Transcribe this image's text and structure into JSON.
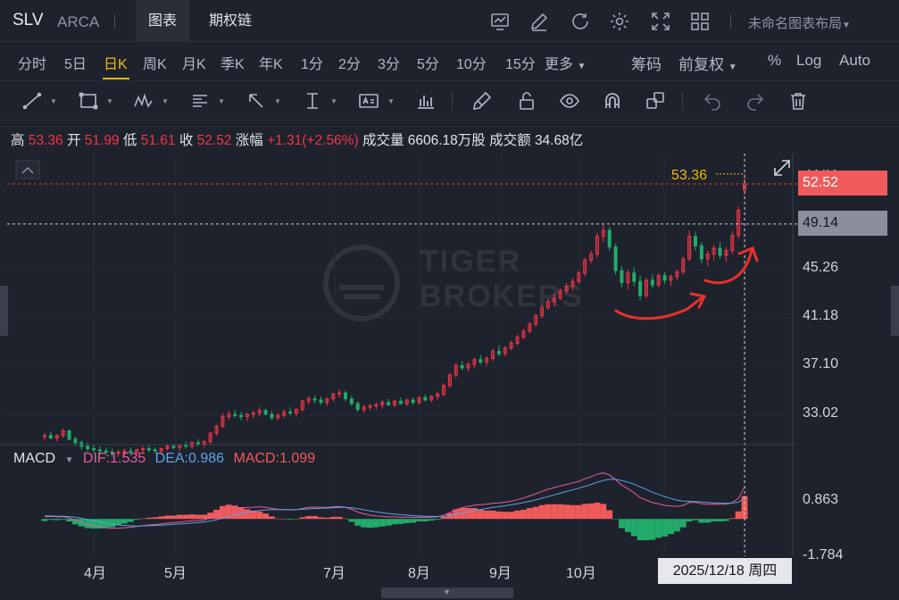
{
  "header": {
    "symbol": "SLV",
    "exchange": "ARCA",
    "tabs": [
      "图表",
      "期权链"
    ],
    "active_tab": 0,
    "layout_name": "未命名图表布局",
    "icons": [
      "chart-indicator-icon",
      "draw-pen-icon",
      "refresh-icon",
      "settings-gear-icon",
      "fullscreen-icon",
      "grid-layout-icon"
    ]
  },
  "periods": {
    "items": [
      "分时",
      "5日",
      "日K",
      "周K",
      "月K",
      "季K",
      "年K",
      "1分",
      "2分",
      "3分",
      "5分",
      "10分",
      "15分",
      "更多"
    ],
    "active": "日K",
    "right_options": [
      "筹码",
      "前复权",
      "%",
      "Log",
      "Auto"
    ]
  },
  "drawing_tools": [
    "trend-line-icon",
    "rectangle-icon",
    "pattern-icon",
    "text-list-icon",
    "arrow-icon",
    "measure-icon",
    "text-annotation-icon",
    "bar-pattern-icon",
    "brush-icon",
    "lock-icon",
    "eye-icon",
    "magnet-icon",
    "layers-icon",
    "undo-icon",
    "redo-icon",
    "trash-icon"
  ],
  "quote": {
    "high_label": "高",
    "high": "53.36",
    "open_label": "开",
    "open": "51.99",
    "low_label": "低",
    "low": "51.61",
    "close_label": "收",
    "close": "52.52",
    "change_label": "涨幅",
    "change": "+1.31(+2.56%)",
    "volume_label": "成交量",
    "volume": "6606.18万股",
    "turnover_label": "成交额",
    "turnover": "34.68亿"
  },
  "price_axis": {
    "top_partial": "53.42",
    "labels": [
      "45.26",
      "41.18",
      "37.10",
      "33.02"
    ],
    "current_price": "52.52",
    "crosshair_price": "49.14",
    "high_marker": "53.36"
  },
  "macd": {
    "title": "MACD",
    "dif_label": "DIF:",
    "dif": "1.535",
    "dea_label": "DEA:",
    "dea": "0.986",
    "macd_label": "MACD:",
    "macd": "1.099",
    "axis_labels": [
      "0.863",
      "-1.784"
    ]
  },
  "time_axis": {
    "months": [
      "4月",
      "5月",
      "7月",
      "8月",
      "9月",
      "10月"
    ],
    "crosshair_date": "2025/12/18 周四"
  },
  "watermark": "TIGER BROKERS",
  "colors": {
    "up": "#f23645",
    "down": "#22ab6a",
    "dif": "#e55d9b",
    "dea": "#5ba3e6",
    "accent": "#f0b90b",
    "annotation": "#e8312a"
  },
  "chart_data": {
    "type": "candlestick",
    "ylim": [
      30.0,
      54.0
    ],
    "macd_ylim": [
      -1.9,
      2.3
    ],
    "candles": [
      [
        31.2,
        31.5,
        30.9,
        31.3
      ],
      [
        31.3,
        31.6,
        31.0,
        31.1
      ],
      [
        31.1,
        31.4,
        30.8,
        31.3
      ],
      [
        31.3,
        31.9,
        31.1,
        31.7
      ],
      [
        31.7,
        31.8,
        30.9,
        31.0
      ],
      [
        31.0,
        31.2,
        30.4,
        30.7
      ],
      [
        30.7,
        30.9,
        30.1,
        30.4
      ],
      [
        30.4,
        30.7,
        29.9,
        30.2
      ],
      [
        30.2,
        30.5,
        29.8,
        30.1
      ],
      [
        30.1,
        30.4,
        29.7,
        30.0
      ],
      [
        30.0,
        30.3,
        29.6,
        29.9
      ],
      [
        29.9,
        30.2,
        29.5,
        29.8
      ],
      [
        29.8,
        30.1,
        29.5,
        29.9
      ],
      [
        29.9,
        30.2,
        29.6,
        30.0
      ],
      [
        30.0,
        30.3,
        29.7,
        29.9
      ],
      [
        29.9,
        30.2,
        29.6,
        30.1
      ],
      [
        30.1,
        30.4,
        29.8,
        30.2
      ],
      [
        30.2,
        30.5,
        29.9,
        30.1
      ],
      [
        30.1,
        30.3,
        29.8,
        30.0
      ],
      [
        30.0,
        30.3,
        29.7,
        30.2
      ],
      [
        30.2,
        30.6,
        30.0,
        30.4
      ],
      [
        30.4,
        30.6,
        30.1,
        30.3
      ],
      [
        30.3,
        30.6,
        30.0,
        30.5
      ],
      [
        30.5,
        30.8,
        30.2,
        30.4
      ],
      [
        30.4,
        30.8,
        30.2,
        30.7
      ],
      [
        30.7,
        31.0,
        30.4,
        30.6
      ],
      [
        30.6,
        30.9,
        30.3,
        30.8
      ],
      [
        30.8,
        31.6,
        30.6,
        31.5
      ],
      [
        31.5,
        32.2,
        31.3,
        32.1
      ],
      [
        32.1,
        33.2,
        31.9,
        32.9
      ],
      [
        32.9,
        33.4,
        32.6,
        33.1
      ],
      [
        33.1,
        33.5,
        32.8,
        33.0
      ],
      [
        33.0,
        33.3,
        32.6,
        32.9
      ],
      [
        32.9,
        33.2,
        32.5,
        33.1
      ],
      [
        33.1,
        33.4,
        32.8,
        33.2
      ],
      [
        33.2,
        33.7,
        32.9,
        33.4
      ],
      [
        33.4,
        33.6,
        33.0,
        33.1
      ],
      [
        33.1,
        33.4,
        32.6,
        32.8
      ],
      [
        32.8,
        33.2,
        32.6,
        33.0
      ],
      [
        33.0,
        33.5,
        32.8,
        33.3
      ],
      [
        33.3,
        33.7,
        33.0,
        33.2
      ],
      [
        33.2,
        33.6,
        32.9,
        33.5
      ],
      [
        33.5,
        34.3,
        33.3,
        34.2
      ],
      [
        34.2,
        34.6,
        33.9,
        34.4
      ],
      [
        34.4,
        34.7,
        34.0,
        34.3
      ],
      [
        34.3,
        34.6,
        33.9,
        34.1
      ],
      [
        34.1,
        34.5,
        33.8,
        34.4
      ],
      [
        34.4,
        34.9,
        34.2,
        34.8
      ],
      [
        34.8,
        35.2,
        34.5,
        34.9
      ],
      [
        34.9,
        35.1,
        34.2,
        34.4
      ],
      [
        34.4,
        34.7,
        33.8,
        34.0
      ],
      [
        34.0,
        34.2,
        33.3,
        33.5
      ],
      [
        33.5,
        33.9,
        33.2,
        33.7
      ],
      [
        33.7,
        34.0,
        33.4,
        33.8
      ],
      [
        33.8,
        34.1,
        33.5,
        33.9
      ],
      [
        33.9,
        34.3,
        33.6,
        34.1
      ],
      [
        34.1,
        34.4,
        33.8,
        33.9
      ],
      [
        33.9,
        34.3,
        33.7,
        34.2
      ],
      [
        34.2,
        34.5,
        33.9,
        34.0
      ],
      [
        34.0,
        34.4,
        33.8,
        34.3
      ],
      [
        34.3,
        34.5,
        33.9,
        34.1
      ],
      [
        34.1,
        34.6,
        33.9,
        34.5
      ],
      [
        34.5,
        34.8,
        34.2,
        34.3
      ],
      [
        34.3,
        34.7,
        34.1,
        34.6
      ],
      [
        34.6,
        35.0,
        34.3,
        34.8
      ],
      [
        34.8,
        35.7,
        34.6,
        35.5
      ],
      [
        35.5,
        36.6,
        35.3,
        36.4
      ],
      [
        36.4,
        37.4,
        36.2,
        37.2
      ],
      [
        37.2,
        37.6,
        36.8,
        37.0
      ],
      [
        37.0,
        37.5,
        36.7,
        37.3
      ],
      [
        37.3,
        37.9,
        37.0,
        37.7
      ],
      [
        37.7,
        38.1,
        37.3,
        37.5
      ],
      [
        37.5,
        38.0,
        37.2,
        37.8
      ],
      [
        37.8,
        38.6,
        37.6,
        38.4
      ],
      [
        38.4,
        38.9,
        38.0,
        38.2
      ],
      [
        38.2,
        38.8,
        38.0,
        38.7
      ],
      [
        38.7,
        39.3,
        38.5,
        39.1
      ],
      [
        39.1,
        39.8,
        38.9,
        39.6
      ],
      [
        39.6,
        40.3,
        39.4,
        40.1
      ],
      [
        40.1,
        40.9,
        39.9,
        40.7
      ],
      [
        40.7,
        41.6,
        40.5,
        41.4
      ],
      [
        41.4,
        42.3,
        41.2,
        42.1
      ],
      [
        42.1,
        42.9,
        41.9,
        42.6
      ],
      [
        42.6,
        43.3,
        42.2,
        42.9
      ],
      [
        42.9,
        43.7,
        42.7,
        43.5
      ],
      [
        43.5,
        44.2,
        43.2,
        43.9
      ],
      [
        43.9,
        44.6,
        43.5,
        44.3
      ],
      [
        44.3,
        45.2,
        44.1,
        45.0
      ],
      [
        45.0,
        46.3,
        44.7,
        46.1
      ],
      [
        46.1,
        46.9,
        45.8,
        46.6
      ],
      [
        46.6,
        48.4,
        46.3,
        48.1
      ],
      [
        48.1,
        49.1,
        47.6,
        48.6
      ],
      [
        48.6,
        48.9,
        46.9,
        47.2
      ],
      [
        47.2,
        47.5,
        44.9,
        45.2
      ],
      [
        45.2,
        45.6,
        43.8,
        44.2
      ],
      [
        44.2,
        45.3,
        43.6,
        45.0
      ],
      [
        45.0,
        45.5,
        43.9,
        44.3
      ],
      [
        44.3,
        44.8,
        42.7,
        43.1
      ],
      [
        43.1,
        44.6,
        42.9,
        44.4
      ],
      [
        44.4,
        44.9,
        43.7,
        44.0
      ],
      [
        44.0,
        45.0,
        43.8,
        44.8
      ],
      [
        44.8,
        45.1,
        44.1,
        44.4
      ],
      [
        44.4,
        44.9,
        43.9,
        44.7
      ],
      [
        44.7,
        45.3,
        44.4,
        45.1
      ],
      [
        45.1,
        46.4,
        44.9,
        46.2
      ],
      [
        46.2,
        48.6,
        46.0,
        48.1
      ],
      [
        48.1,
        48.5,
        46.9,
        47.3
      ],
      [
        47.3,
        47.6,
        45.8,
        46.2
      ],
      [
        46.2,
        46.9,
        45.6,
        46.6
      ],
      [
        46.6,
        47.4,
        46.1,
        47.1
      ],
      [
        47.1,
        47.6,
        46.2,
        46.5
      ],
      [
        46.5,
        47.2,
        45.9,
        46.9
      ],
      [
        46.9,
        48.5,
        46.6,
        48.2
      ],
      [
        48.2,
        50.6,
        47.9,
        50.3
      ],
      [
        51.99,
        53.36,
        51.61,
        52.52
      ]
    ],
    "dif": [
      0.1,
      0.12,
      0.1,
      0.11,
      0.05,
      -0.05,
      -0.15,
      -0.25,
      -0.32,
      -0.38,
      -0.42,
      -0.45,
      -0.44,
      -0.42,
      -0.4,
      -0.36,
      -0.32,
      -0.29,
      -0.27,
      -0.24,
      -0.2,
      -0.18,
      -0.14,
      -0.12,
      -0.08,
      -0.07,
      -0.04,
      0.05,
      0.18,
      0.35,
      0.46,
      0.52,
      0.54,
      0.55,
      0.56,
      0.58,
      0.56,
      0.5,
      0.46,
      0.45,
      0.43,
      0.44,
      0.5,
      0.55,
      0.57,
      0.55,
      0.55,
      0.58,
      0.6,
      0.56,
      0.46,
      0.33,
      0.24,
      0.18,
      0.14,
      0.12,
      0.1,
      0.1,
      0.08,
      0.08,
      0.07,
      0.08,
      0.07,
      0.08,
      0.1,
      0.18,
      0.3,
      0.45,
      0.54,
      0.6,
      0.66,
      0.68,
      0.7,
      0.75,
      0.77,
      0.8,
      0.85,
      0.92,
      1.0,
      1.1,
      1.2,
      1.32,
      1.42,
      1.5,
      1.58,
      1.65,
      1.72,
      1.8,
      1.92,
      2.02,
      2.14,
      2.2,
      2.1,
      1.88,
      1.62,
      1.45,
      1.25,
      1.02,
      0.9,
      0.78,
      0.72,
      0.65,
      0.62,
      0.6,
      0.65,
      0.78,
      0.8,
      0.72,
      0.7,
      0.71,
      0.7,
      0.7,
      0.78,
      0.98,
      1.535
    ],
    "dea": [
      0.15,
      0.14,
      0.13,
      0.13,
      0.11,
      0.08,
      0.03,
      -0.03,
      -0.09,
      -0.15,
      -0.2,
      -0.25,
      -0.29,
      -0.31,
      -0.33,
      -0.34,
      -0.33,
      -0.32,
      -0.31,
      -0.3,
      -0.28,
      -0.26,
      -0.24,
      -0.22,
      -0.19,
      -0.17,
      -0.14,
      -0.1,
      -0.04,
      0.04,
      0.12,
      0.2,
      0.26,
      0.32,
      0.36,
      0.4,
      0.43,
      0.44,
      0.45,
      0.45,
      0.45,
      0.45,
      0.46,
      0.48,
      0.5,
      0.51,
      0.52,
      0.53,
      0.55,
      0.55,
      0.53,
      0.49,
      0.44,
      0.39,
      0.34,
      0.3,
      0.26,
      0.23,
      0.2,
      0.18,
      0.16,
      0.14,
      0.13,
      0.12,
      0.12,
      0.13,
      0.16,
      0.22,
      0.28,
      0.34,
      0.4,
      0.45,
      0.5,
      0.55,
      0.59,
      0.63,
      0.68,
      0.72,
      0.78,
      0.84,
      0.91,
      0.99,
      1.07,
      1.15,
      1.23,
      1.31,
      1.39,
      1.47,
      1.56,
      1.65,
      1.75,
      1.84,
      1.89,
      1.89,
      1.84,
      1.76,
      1.66,
      1.53,
      1.41,
      1.28,
      1.17,
      1.07,
      0.98,
      0.9,
      0.85,
      0.84,
      0.83,
      0.81,
      0.79,
      0.77,
      0.76,
      0.75,
      0.76,
      0.8,
      0.986
    ]
  }
}
